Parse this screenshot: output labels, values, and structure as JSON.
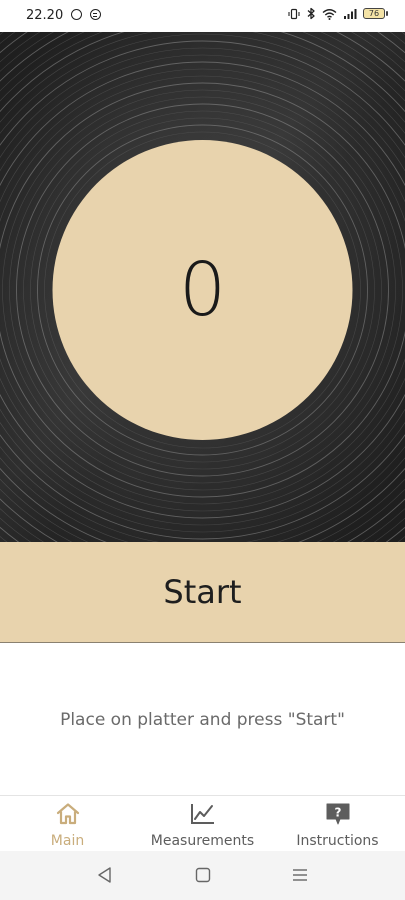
{
  "status_bar": {
    "time": "22.20",
    "battery": "76",
    "icons": [
      "whatsapp-icon",
      "messenger-icon",
      "vibrate-icon",
      "bluetooth-icon",
      "wifi-icon",
      "signal-icon",
      "battery-icon"
    ]
  },
  "main": {
    "counter": "0",
    "start_label": "Start",
    "instruction": "Place on platter and press \"Start\""
  },
  "bottom_nav": {
    "items": [
      {
        "label": "Main",
        "icon": "home-icon",
        "active": true
      },
      {
        "label": "Measurements",
        "icon": "line-chart-icon",
        "active": false
      },
      {
        "label": "Instructions",
        "icon": "help-bubble-icon",
        "active": false
      }
    ]
  },
  "system_nav": {
    "buttons": [
      "back-icon",
      "home-square-icon",
      "recents-menu-icon"
    ]
  },
  "colors": {
    "accent": "#c9ad7c",
    "label_beige": "#e8d3ad",
    "vinyl": "#2b2b2b"
  }
}
